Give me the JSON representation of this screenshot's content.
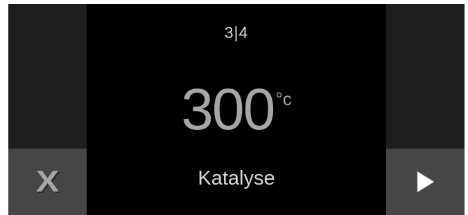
{
  "display": {
    "step_indicator": "3|4",
    "temperature_value": "300",
    "temperature_unit": "°c",
    "program_name": "Katalyse"
  },
  "buttons": {
    "cancel_glyph": "X",
    "next_icon": "play-arrow-icon"
  },
  "colors": {
    "screen_background": "#000000",
    "side_panel": "#1e1e1e",
    "button_background": "#464646",
    "primary_text": "#d9d9d9",
    "dimmed_text": "#a6a6a6"
  }
}
